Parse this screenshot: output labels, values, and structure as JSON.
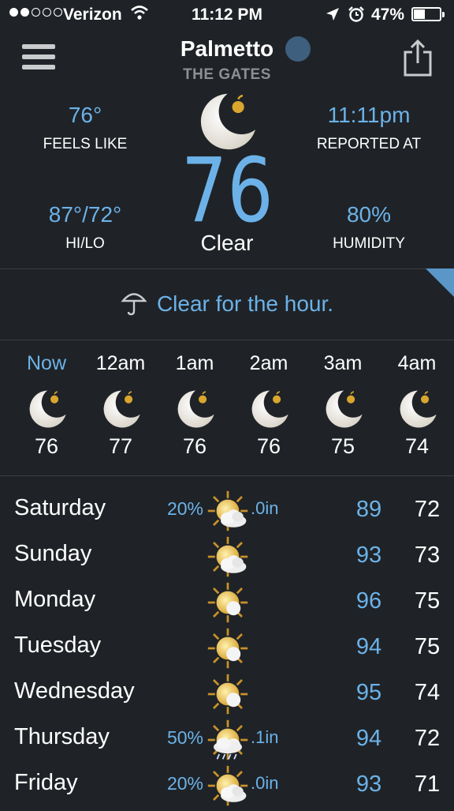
{
  "status_bar": {
    "carrier": "Verizon",
    "time": "11:12 PM",
    "battery": "47%",
    "battery_level": 0.47,
    "signal_bars_filled": 2,
    "signal_bars_total": 5
  },
  "header": {
    "city": "Palmetto",
    "sublocation": "THE GATES"
  },
  "current": {
    "feels_like_value": "76°",
    "feels_like_label": "FEELS LIKE",
    "reported_value": "11:11pm",
    "reported_label": "REPORTED AT",
    "temp": "76",
    "condition": "Clear",
    "hilo_value": "87°/72°",
    "hilo_label": "HI/LO",
    "humidity_value": "80%",
    "humidity_label": "HUMIDITY"
  },
  "summary": "Clear for the hour.",
  "hourly": [
    {
      "label": "Now",
      "temp": "76",
      "icon": "moon-icon"
    },
    {
      "label": "12am",
      "temp": "77",
      "icon": "moon-icon"
    },
    {
      "label": "1am",
      "temp": "76",
      "icon": "moon-icon"
    },
    {
      "label": "2am",
      "temp": "76",
      "icon": "moon-icon"
    },
    {
      "label": "3am",
      "temp": "75",
      "icon": "moon-icon"
    },
    {
      "label": "4am",
      "temp": "74",
      "icon": "moon-icon"
    }
  ],
  "daily": [
    {
      "day": "Saturday",
      "precip": "20%",
      "accum": ".0in",
      "hi": "89",
      "lo": "72",
      "icon": "sun-cloud-icon"
    },
    {
      "day": "Sunday",
      "precip": "",
      "accum": "",
      "hi": "93",
      "lo": "73",
      "icon": "sun-cloud-icon"
    },
    {
      "day": "Monday",
      "precip": "",
      "accum": "",
      "hi": "96",
      "lo": "75",
      "icon": "sun-icon"
    },
    {
      "day": "Tuesday",
      "precip": "",
      "accum": "",
      "hi": "94",
      "lo": "75",
      "icon": "sun-icon"
    },
    {
      "day": "Wednesday",
      "precip": "",
      "accum": "",
      "hi": "95",
      "lo": "74",
      "icon": "sun-icon"
    },
    {
      "day": "Thursday",
      "precip": "50%",
      "accum": ".1in",
      "hi": "94",
      "lo": "72",
      "icon": "sun-rain-icon"
    },
    {
      "day": "Friday",
      "precip": "20%",
      "accum": ".0in",
      "hi": "93",
      "lo": "71",
      "icon": "sun-cloud-icon"
    }
  ],
  "colors": {
    "background": "#1f2327",
    "accent": "#6cb2e8",
    "muted": "#8c9094"
  }
}
